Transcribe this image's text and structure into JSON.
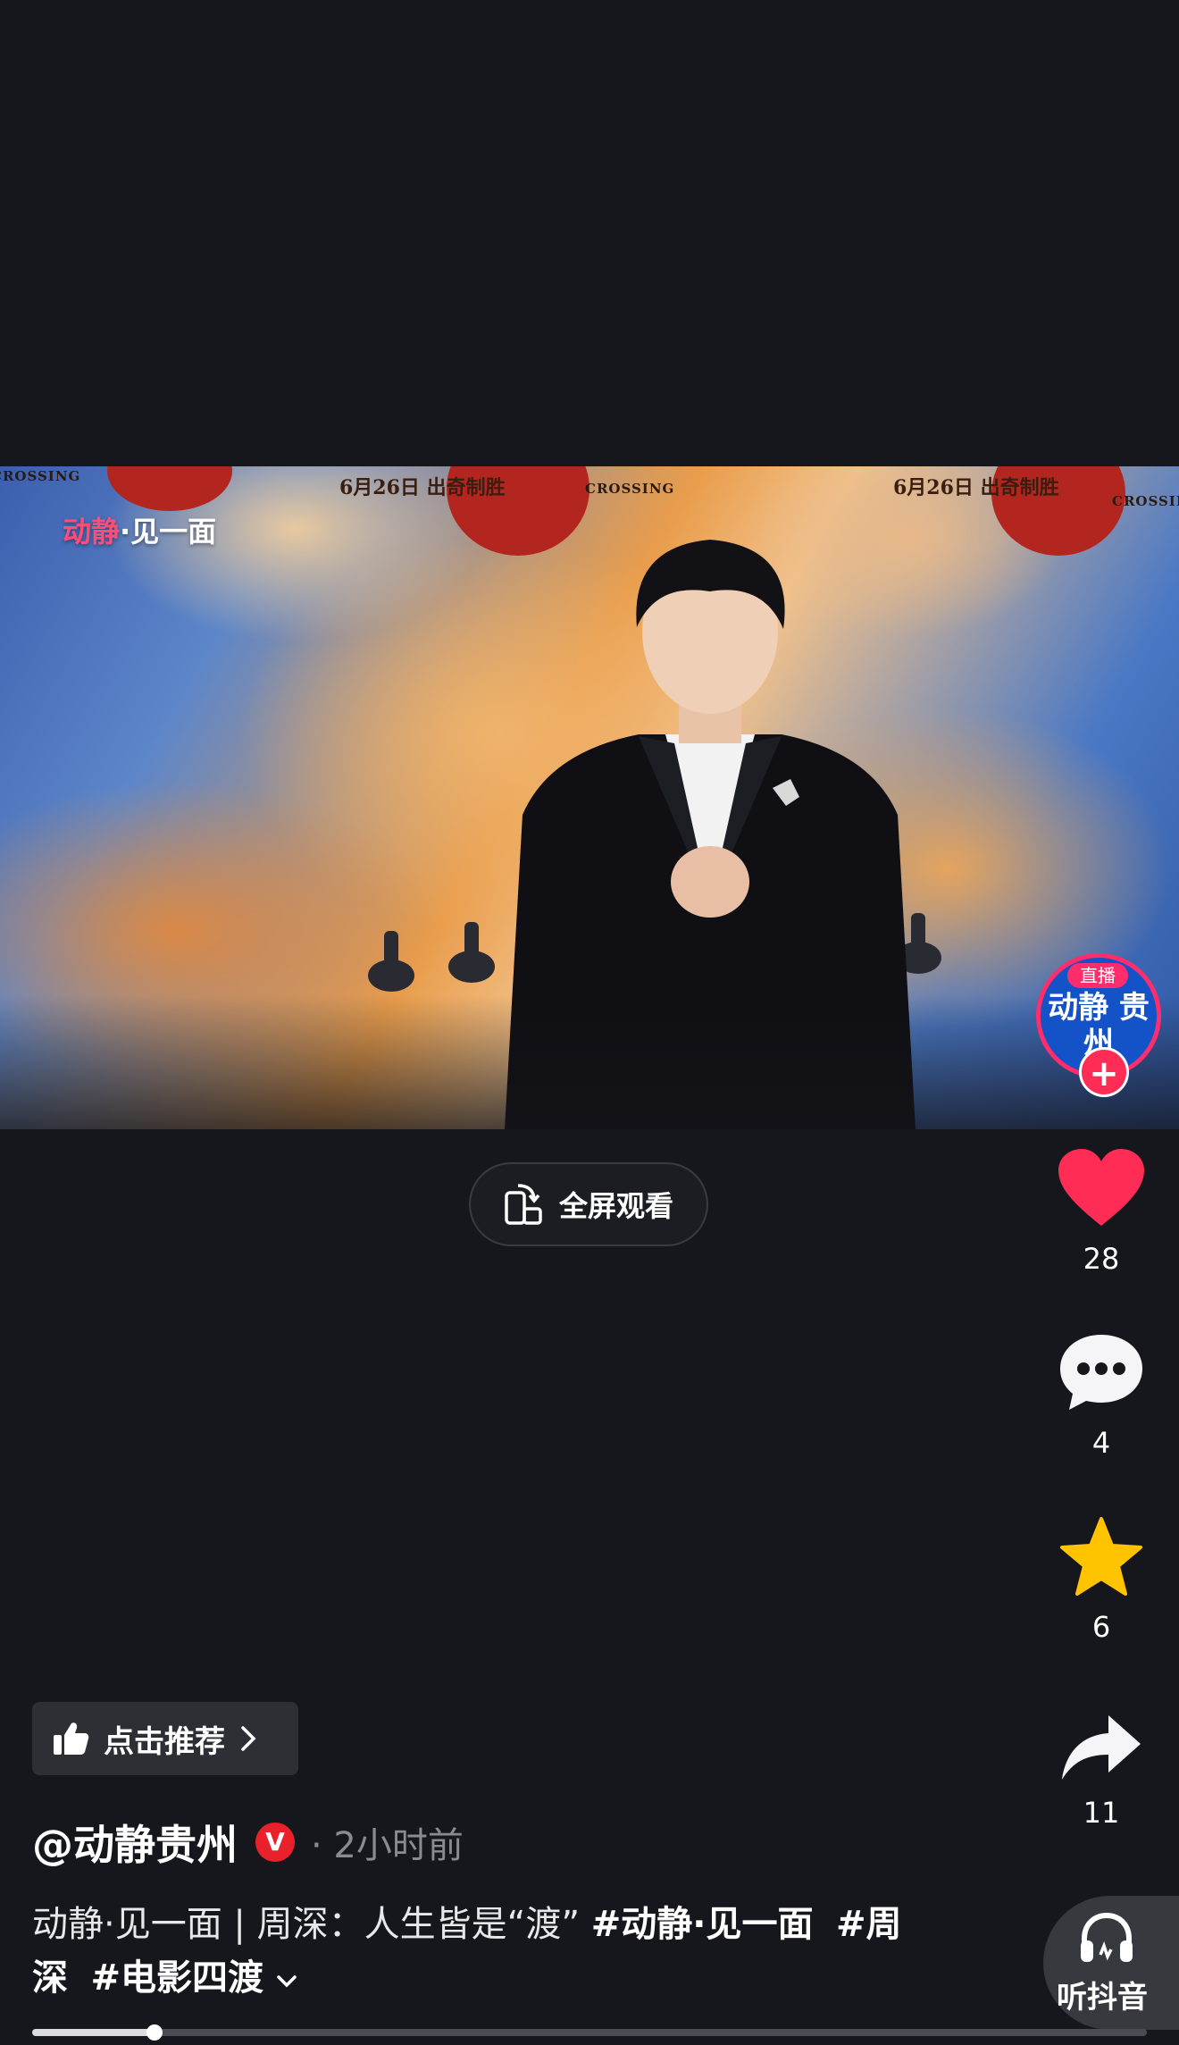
{
  "video": {
    "logo_part1": "动静",
    "logo_part2": "·见一面",
    "poster_date_left": "6月26日 出奇制胜",
    "poster_date_right": "6月26日 出奇制胜",
    "poster_crossing_1": "CROSSING",
    "poster_crossing_2": "CROSSING",
    "poster_crossing_3": "CROSSING",
    "live_tag": "直播",
    "live_channel": "动静 贵州"
  },
  "fullscreen": {
    "label": "全屏观看"
  },
  "actions": {
    "likes": "28",
    "comments": "4",
    "favorites": "6",
    "shares": "11"
  },
  "recommend": {
    "label": "点击推荐"
  },
  "author": {
    "handle": "@动静贵州",
    "verified_mark": "V",
    "time": "· 2小时前"
  },
  "description": {
    "text": "动静·见一面 | 周深：人生皆是“渡” ",
    "tag1": "#动静·见一面",
    "tag2": "#周深",
    "tag3": "#电影四渡"
  },
  "listen": {
    "label": "听抖音"
  },
  "progress": {
    "fraction": 0.11
  },
  "colors": {
    "like": "#ff2d55",
    "star": "#ffc300",
    "background": "#16171d"
  },
  "icons": [
    "heart-icon",
    "comment-icon",
    "star-icon",
    "share-icon",
    "headphones-icon",
    "thumbs-up-icon",
    "chevron-right-icon",
    "chevron-down-icon",
    "fullscreen-rotate-icon"
  ]
}
